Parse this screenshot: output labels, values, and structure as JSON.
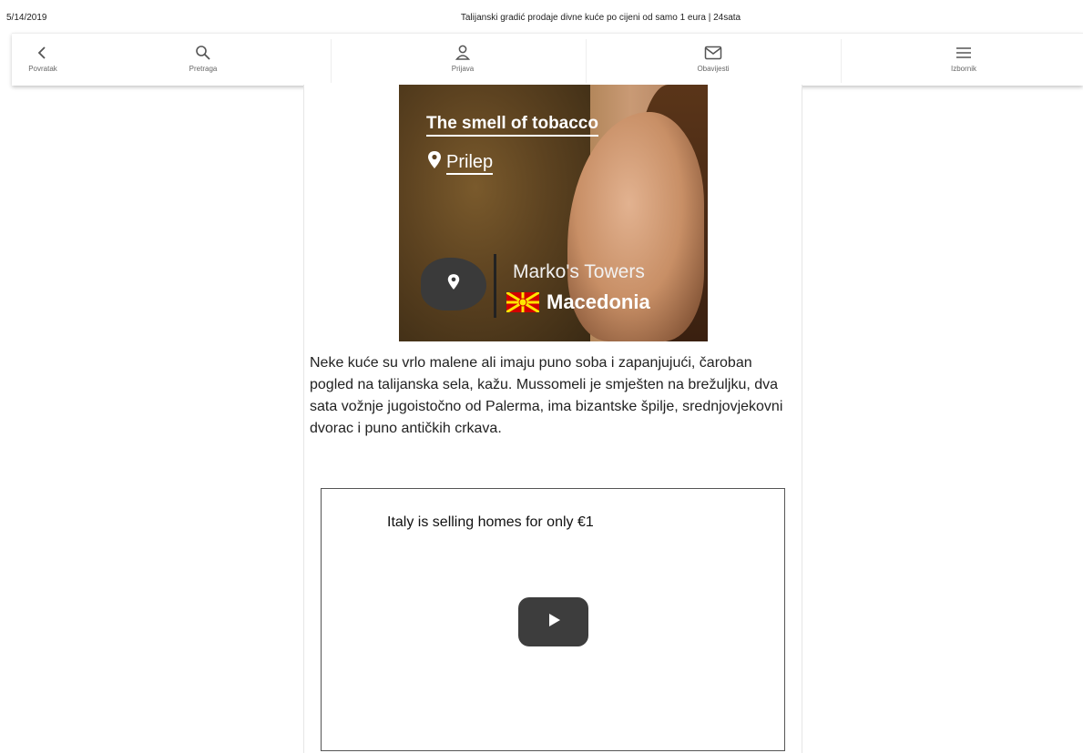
{
  "print_header": {
    "date": "5/14/2019",
    "title": "Talijanski gradić prodaje divne kuće po cijeni od samo 1 eura | 24sata"
  },
  "nav": {
    "items": [
      {
        "label": "Povratak",
        "icon": "chevron-left-icon"
      },
      {
        "label": "Pretraga",
        "icon": "search-icon"
      },
      {
        "label": "Prijava",
        "icon": "user-icon"
      },
      {
        "label": "Obavijesti",
        "icon": "envelope-icon"
      },
      {
        "label": "Izbornik",
        "icon": "menu-icon"
      }
    ]
  },
  "hero": {
    "title": "The smell of tobacco",
    "place": "Prilep",
    "subtitle": "Marko's Towers",
    "country": "Macedonia",
    "colors": {
      "flag_red": "#d20000",
      "flag_yellow": "#ffe600"
    }
  },
  "article": {
    "paragraph": "Neke kuće su vrlo malene ali imaju puno soba i zapanjujući, čaroban pogled na talijanska sela, kažu. Mussomeli je smješten na brežuljku, dva sata vožnje jugoistočno od Palerma, ima bizantske špilje, srednjovjekovni dvorac i puno antičkih crkava."
  },
  "video": {
    "title": "Italy is selling homes for only €1",
    "play_icon": "play-icon"
  }
}
